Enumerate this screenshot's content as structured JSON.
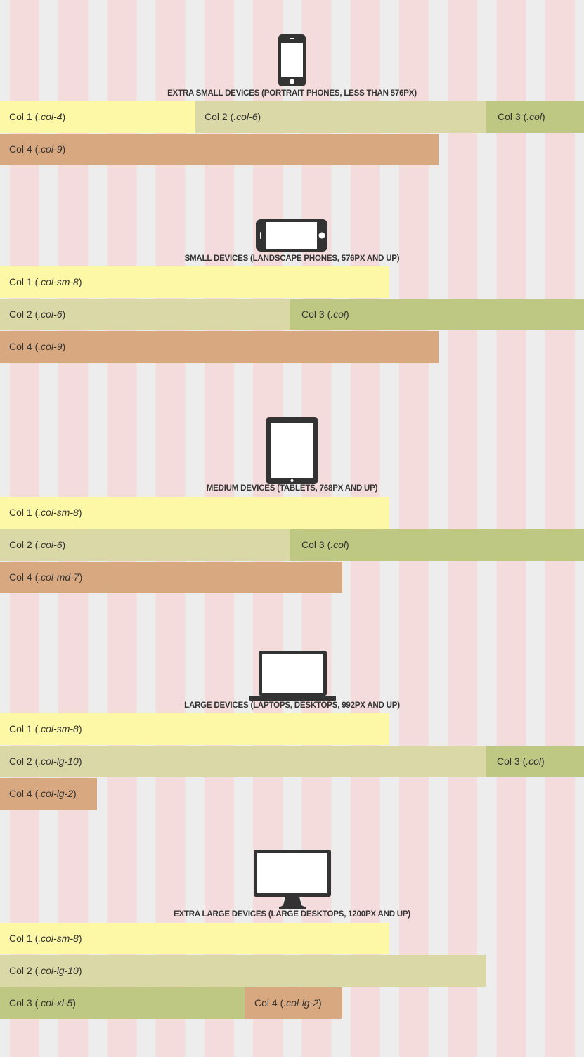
{
  "sections": [
    {
      "icon": "phone-portrait-icon",
      "title": "EXTRA SMALL DEVICES (PORTRAIT PHONES, LESS THAN 576PX)",
      "columns": [
        {
          "label": "Col 1",
          "class_name": ".col-4"
        },
        {
          "label": "Col 2",
          "class_name": ".col-6"
        },
        {
          "label": "Col 3",
          "class_name": ".col"
        },
        {
          "label": "Col 4",
          "class_name": ".col-9"
        }
      ]
    },
    {
      "icon": "phone-landscape-icon",
      "title": "SMALL DEVICES (LANDSCAPE PHONES, 576PX AND UP)",
      "columns": [
        {
          "label": "Col 1",
          "class_name": ".col-sm-8"
        },
        {
          "label": "Col 2",
          "class_name": ".col-6"
        },
        {
          "label": "Col 3",
          "class_name": ".col"
        },
        {
          "label": "Col 4",
          "class_name": ".col-9"
        }
      ]
    },
    {
      "icon": "tablet-icon",
      "title": "MEDIUM DEVICES (TABLETS, 768PX AND UP)",
      "columns": [
        {
          "label": "Col 1",
          "class_name": ".col-sm-8"
        },
        {
          "label": "Col 2",
          "class_name": ".col-6"
        },
        {
          "label": "Col 3",
          "class_name": ".col"
        },
        {
          "label": "Col 4",
          "class_name": ".col-md-7"
        }
      ]
    },
    {
      "icon": "laptop-icon",
      "title": "LARGE DEVICES (LAPTOPS, DESKTOPS, 992PX AND UP)",
      "columns": [
        {
          "label": "Col 1",
          "class_name": ".col-sm-8"
        },
        {
          "label": "Col 2",
          "class_name": ".col-lg-10"
        },
        {
          "label": "Col 3",
          "class_name": ".col"
        },
        {
          "label": "Col 4",
          "class_name": ".col-lg-2"
        }
      ]
    },
    {
      "icon": "desktop-monitor-icon",
      "title": "EXTRA LARGE DEVICES (LARGE DESKTOPS, 1200PX AND UP)",
      "columns": [
        {
          "label": "Col 1",
          "class_name": ".col-sm-8"
        },
        {
          "label": "Col 2",
          "class_name": ".col-lg-10"
        },
        {
          "label": "Col 3",
          "class_name": ".col-xl-5"
        },
        {
          "label": "Col 4",
          "class_name": ".col-lg-2"
        }
      ]
    }
  ],
  "colors": {
    "col1": "#fdf8a6",
    "col2": "#dbd8a8",
    "col3": "#bec883",
    "col4": "#d8a980",
    "grid_stripe": "#f5dcdc",
    "background": "#ededed",
    "icon": "#333333"
  }
}
